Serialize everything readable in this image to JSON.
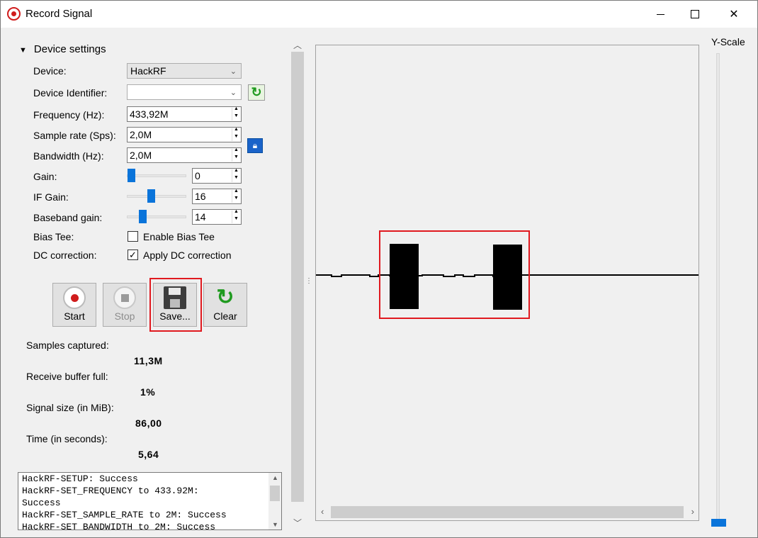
{
  "window": {
    "title": "Record Signal"
  },
  "device_settings": {
    "header": "Device settings",
    "device_label": "Device:",
    "device_value": "HackRF",
    "identifier_label": "Device Identifier:",
    "identifier_value": "",
    "frequency_label": "Frequency (Hz):",
    "frequency_value": "433,92M",
    "sample_rate_label": "Sample rate (Sps):",
    "sample_rate_value": "2,0M",
    "bandwidth_label": "Bandwidth (Hz):",
    "bandwidth_value": "2,0M",
    "gain_label": "Gain:",
    "gain_value": "0",
    "if_gain_label": "IF Gain:",
    "if_gain_value": "16",
    "baseband_label": "Baseband gain:",
    "baseband_value": "14",
    "bias_label": "Bias Tee:",
    "bias_checkbox_label": "Enable Bias Tee",
    "bias_checked": false,
    "dc_label": "DC correction:",
    "dc_checkbox_label": "Apply DC correction",
    "dc_checked": true
  },
  "toolbar": {
    "start_label": "Start",
    "stop_label": "Stop",
    "save_label": "Save...",
    "clear_label": "Clear"
  },
  "stats": {
    "samples_label": "Samples captured:",
    "samples_value": "11,3M",
    "buffer_label": "Receive buffer full:",
    "buffer_value": "1%",
    "size_label": "Signal size (in MiB):",
    "size_value": "86,00",
    "time_label": "Time (in seconds):",
    "time_value": "5,64"
  },
  "log": {
    "lines": [
      "HackRF-SETUP: Success",
      "HackRF-SET_FREQUENCY to 433.92M:",
      "Success",
      "HackRF-SET_SAMPLE_RATE to 2M: Success",
      "HackRF-SET_BANDWIDTH to 2M: Success"
    ]
  },
  "yscale": {
    "label": "Y-Scale"
  },
  "colors": {
    "accent": "#0a74da",
    "highlight": "#e0191f",
    "record": "#d01c1c",
    "refresh": "#1f9a1f"
  },
  "icons": {
    "app": "record-icon",
    "refresh": "refresh-icon",
    "lock": "lock-icon",
    "start": "record-icon",
    "stop": "stop-icon",
    "save": "floppy-disk-icon",
    "clear": "refresh-icon"
  }
}
